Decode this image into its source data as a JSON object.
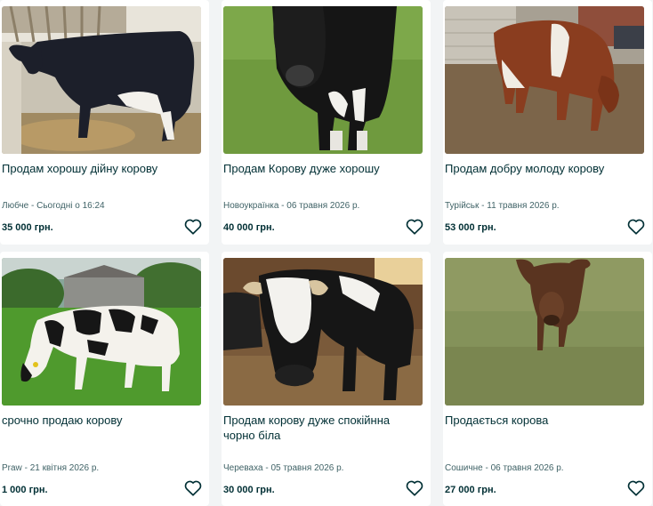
{
  "listings": [
    {
      "title": "Продам хорошу дійну корову",
      "location": "Любче",
      "date": "Сьогодні о 16:24",
      "price": "35 000 грн."
    },
    {
      "title": "Продам Корову дуже хорошу",
      "location": "Новоукраїнка",
      "date": "06 травня 2026 р.",
      "price": "40 000 грн."
    },
    {
      "title": "Продам добру молоду корову",
      "location": "Турійськ",
      "date": "11 травня 2026 р.",
      "price": "53 000 грн."
    },
    {
      "title": "срочно продаю корову",
      "location": "Praw",
      "date": "21 квітня 2026 р.",
      "price": "1 000 грн."
    },
    {
      "title": "Продам корову дуже спокійнна чорно біла",
      "location": "Череваха",
      "date": "05 травня 2026 р.",
      "price": "30 000 грн."
    },
    {
      "title": "Продається корова",
      "location": "Сошичне",
      "date": "06 травня 2026 р.",
      "price": "27 000 грн."
    }
  ],
  "meta_separator": " - ",
  "icons": {
    "favorite": "heart-outline-icon"
  }
}
